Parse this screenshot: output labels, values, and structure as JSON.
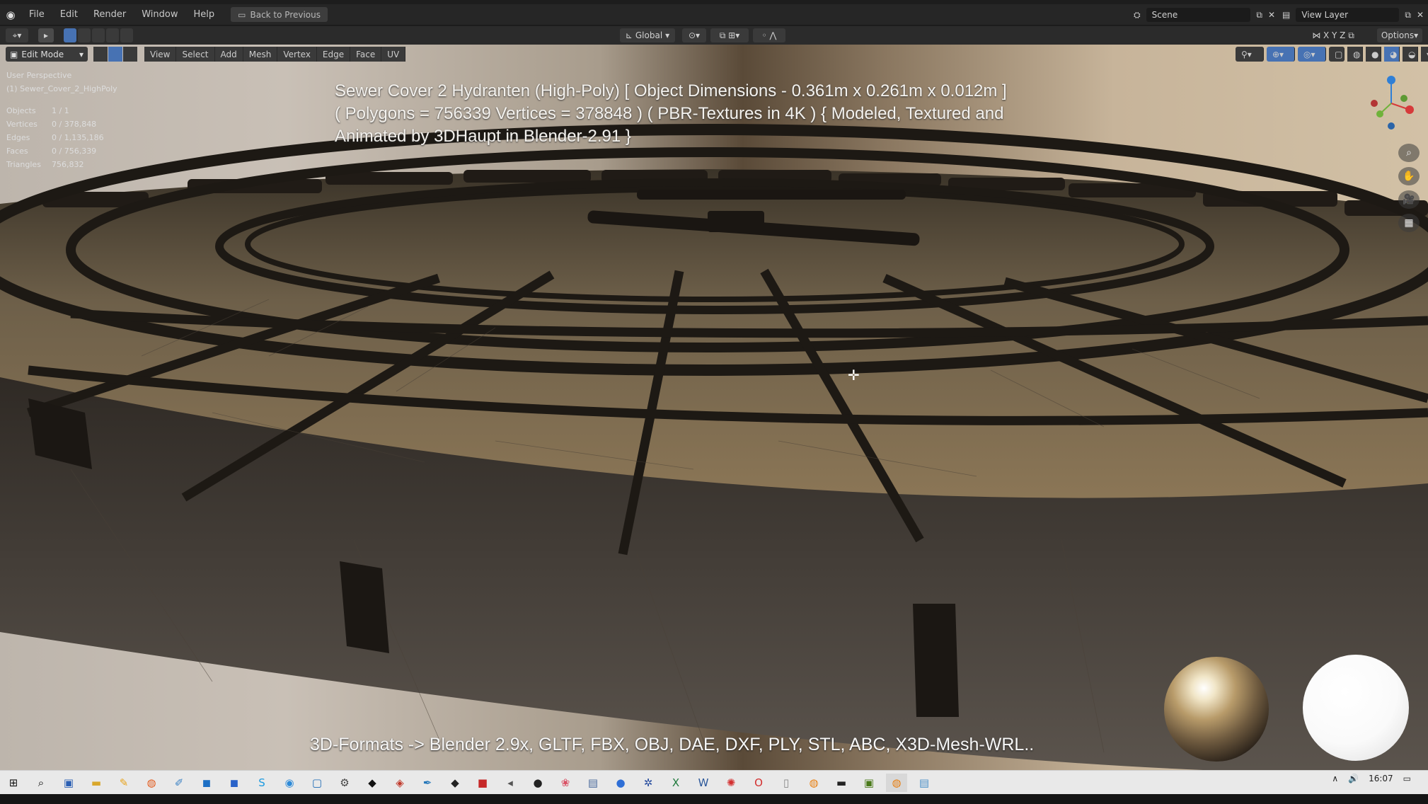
{
  "app": {
    "menu": [
      "File",
      "Edit",
      "Render",
      "Window",
      "Help"
    ],
    "back_label": "Back to Previous",
    "scene_label": "Scene",
    "view_layer_label": "View Layer",
    "options_label": "Options",
    "transform_orientation": "Global"
  },
  "viewport_header": {
    "mode": "Edit Mode",
    "menus": [
      "View",
      "Select",
      "Add",
      "Mesh",
      "Vertex",
      "Edge",
      "Face",
      "UV"
    ]
  },
  "viewport_info": {
    "perspective": "User Perspective",
    "object": "(1) Sewer_Cover_2_HighPoly",
    "stats": [
      {
        "key": "Objects",
        "value": "1 / 1"
      },
      {
        "key": "Vertices",
        "value": "0 / 378,848"
      },
      {
        "key": "Edges",
        "value": "0 / 1,135,186"
      },
      {
        "key": "Faces",
        "value": "0 / 756,339"
      },
      {
        "key": "Triangles",
        "value": "756,832"
      }
    ]
  },
  "overlay": {
    "title_line1": "Sewer Cover 2 Hydranten (High-Poly) [ Object Dimensions -  0.361m x 0.261m x 0.012m ]",
    "title_line2": "( Polygons = 756339 Vertices = 378848 ) ( PBR-Textures in 4K ) { Modeled, Textured and",
    "title_line3": "Animated by 3DHaupt in Blender-2.91 }",
    "formats": "3D-Formats -> Blender 2.9x, GLTF, FBX, OBJ, DAE, DXF, PLY, STL, ABC, X3D-Mesh-WRL.."
  },
  "taskbar": {
    "time": "16:07",
    "icons": [
      "windows-start-icon",
      "search-icon",
      "save-icon",
      "folder-icon",
      "paint-icon",
      "firefox-icon",
      "notepad-icon",
      "outlook-icon",
      "photoshop-icon",
      "skype-icon",
      "chrome-icon",
      "app-icon",
      "terminal-icon",
      "unity-icon",
      "tool-icon",
      "inkscape-icon",
      "gem-icon",
      "adobe-icon",
      "app2-icon",
      "obs-icon",
      "map-icon",
      "calc-icon",
      "browser-icon",
      "gear-icon",
      "excel-icon",
      "word-icon",
      "star-icon",
      "opera-icon",
      "file-icon",
      "blender-icon",
      "cmd-icon",
      "app3-icon",
      "blender-active-icon",
      "notes-icon"
    ]
  },
  "colors": {
    "header_bg": "#262626",
    "accent": "#4772b3",
    "taskbar_bg": "#e9e9e9"
  }
}
